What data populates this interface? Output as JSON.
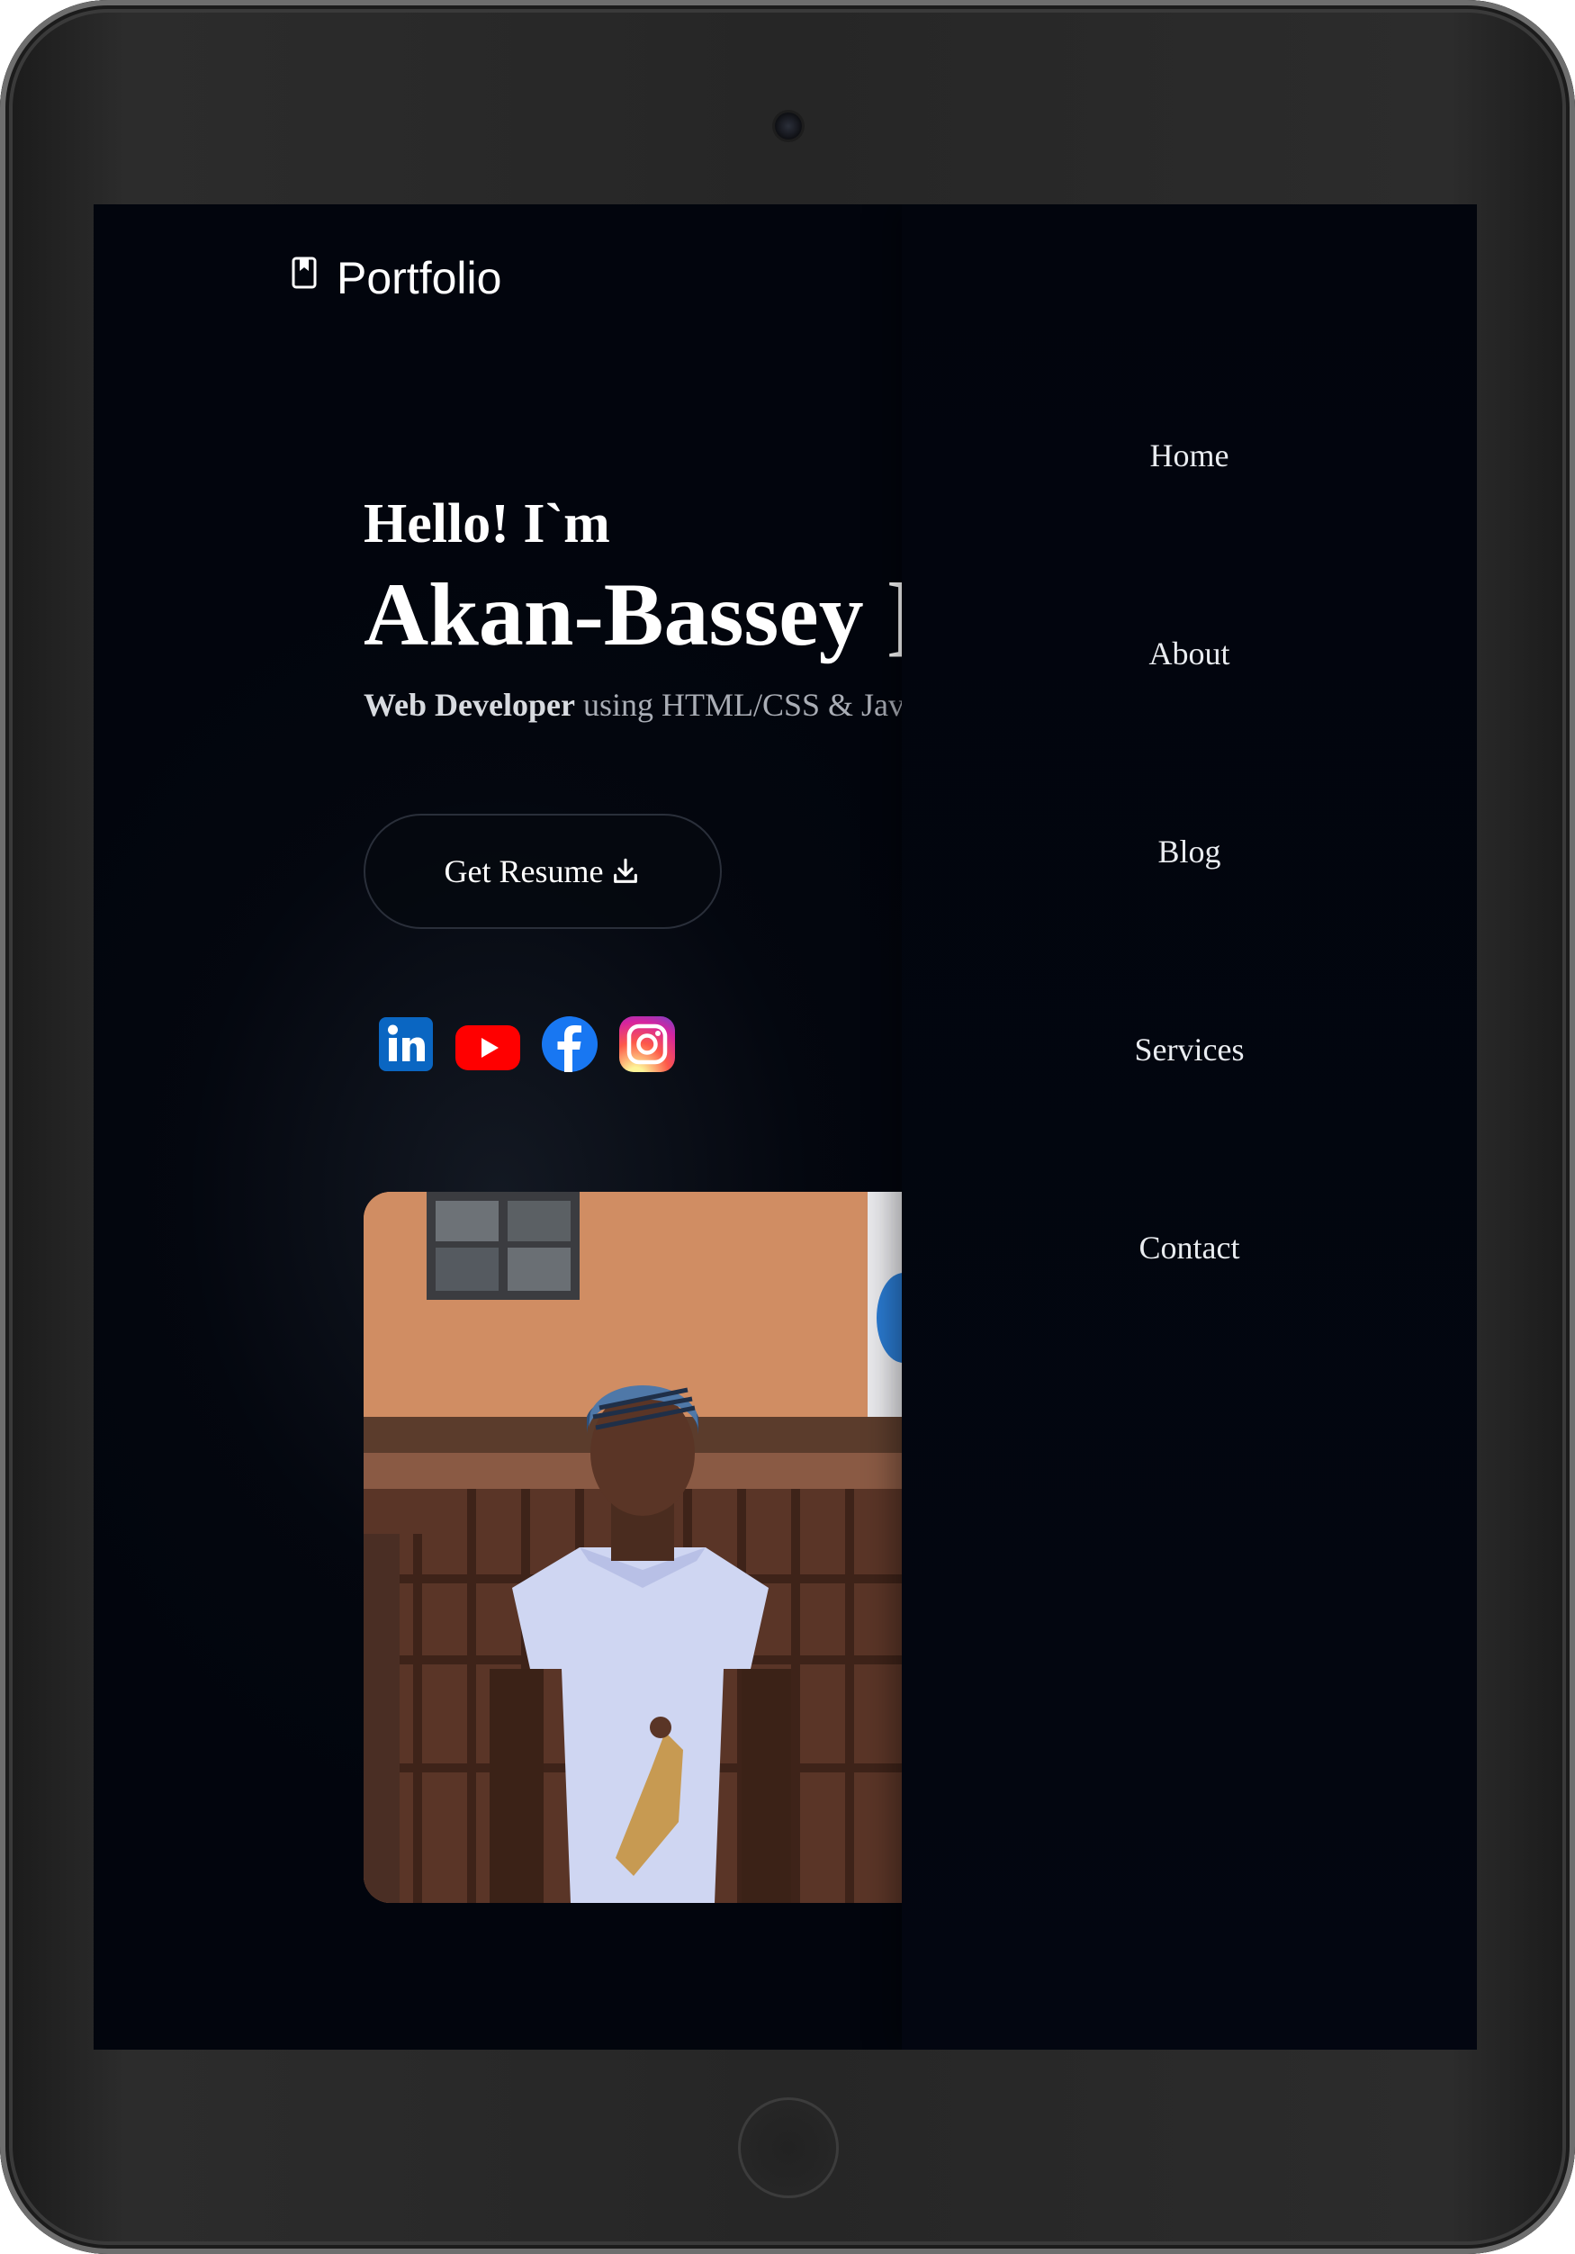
{
  "brand": {
    "name": "Portfolio",
    "icon": "bookmark-icon"
  },
  "close": {
    "icon": "close-icon",
    "color": "#d40000"
  },
  "hero": {
    "greeting": "Hello! I`m",
    "name": "Akan-Bassey ]",
    "role_bold": "Web Developer",
    "role_rest": " using HTML/CSS & Jav",
    "resume_label": "Get Resume",
    "resume_icon": "download-icon"
  },
  "socials": [
    {
      "name": "LinkedIn",
      "icon": "linkedin-icon",
      "color": "#0a66c2"
    },
    {
      "name": "YouTube",
      "icon": "youtube-icon",
      "color": "#ff0000"
    },
    {
      "name": "Facebook",
      "icon": "facebook-icon",
      "color": "#1877f2"
    },
    {
      "name": "Instagram",
      "icon": "instagram-icon",
      "color": "#e1306c"
    }
  ],
  "nav": {
    "items": [
      {
        "label": "Home"
      },
      {
        "label": "About"
      },
      {
        "label": "Blog"
      },
      {
        "label": "Services"
      },
      {
        "label": "Contact"
      }
    ]
  },
  "colors": {
    "background": "#02050d",
    "accent": "#d40000"
  }
}
